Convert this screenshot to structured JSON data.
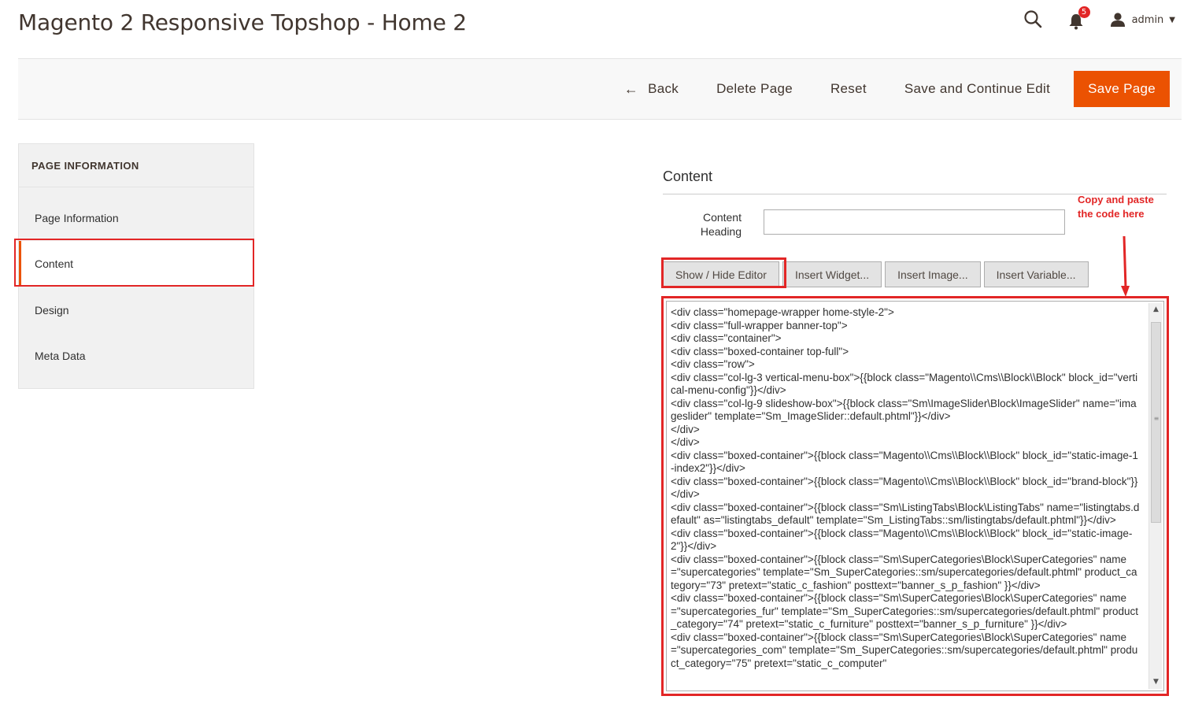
{
  "header": {
    "title": "Magento 2 Responsive Topshop - Home 2",
    "notification_count": "5",
    "user_name": "admin"
  },
  "actions": {
    "back": "Back",
    "delete": "Delete Page",
    "reset": "Reset",
    "save_continue": "Save and Continue Edit",
    "save": "Save Page"
  },
  "sidebar": {
    "title": "PAGE INFORMATION",
    "items": [
      {
        "label": "Page Information"
      },
      {
        "label": "Content"
      },
      {
        "label": "Design"
      },
      {
        "label": "Meta Data"
      }
    ]
  },
  "content": {
    "section_title": "Content",
    "heading_label": "Content Heading",
    "heading_value": "",
    "editor_buttons": {
      "show_hide": "Show / Hide Editor",
      "widget": "Insert Widget...",
      "image": "Insert Image...",
      "variable": "Insert Variable..."
    },
    "editor_value": "<div class=\"homepage-wrapper home-style-2\">\n<div class=\"full-wrapper banner-top\">\n<div class=\"container\">\n<div class=\"boxed-container top-full\">\n<div class=\"row\">\n<div class=\"col-lg-3 vertical-menu-box\">{{block class=\"Magento\\\\Cms\\\\Block\\\\Block\" block_id=\"vertical-menu-config\"}}</div>\n<div class=\"col-lg-9 slideshow-box\">{{block class=\"Sm\\ImageSlider\\Block\\ImageSlider\" name=\"imageslider\" template=\"Sm_ImageSlider::default.phtml\"}}</div>\n</div>\n</div>\n<div class=\"boxed-container\">{{block class=\"Magento\\\\Cms\\\\Block\\\\Block\" block_id=\"static-image-1-index2\"}}</div>\n<div class=\"boxed-container\">{{block class=\"Magento\\\\Cms\\\\Block\\\\Block\" block_id=\"brand-block\"}}</div>\n<div class=\"boxed-container\">{{block class=\"Sm\\ListingTabs\\Block\\ListingTabs\" name=\"listingtabs.default\" as=\"listingtabs_default\" template=\"Sm_ListingTabs::sm/listingtabs/default.phtml\"}}</div>\n<div class=\"boxed-container\">{{block class=\"Magento\\\\Cms\\\\Block\\\\Block\" block_id=\"static-image-2\"}}</div>\n<div class=\"boxed-container\">{{block class=\"Sm\\SuperCategories\\Block\\SuperCategories\" name=\"supercategories\" template=\"Sm_SuperCategories::sm/supercategories/default.phtml\" product_category=\"73\" pretext=\"static_c_fashion\" posttext=\"banner_s_p_fashion\" }}</div>\n<div class=\"boxed-container\">{{block class=\"Sm\\SuperCategories\\Block\\SuperCategories\" name=\"supercategories_fur\" template=\"Sm_SuperCategories::sm/supercategories/default.phtml\" product_category=\"74\" pretext=\"static_c_furniture\" posttext=\"banner_s_p_furniture\" }}</div>\n<div class=\"boxed-container\">{{block class=\"Sm\\SuperCategories\\Block\\SuperCategories\" name=\"supercategories_com\" template=\"Sm_SuperCategories::sm/supercategories/default.phtml\" product_category=\"75\" pretext=\"static_c_computer\""
  },
  "annotation": {
    "text": "Copy and paste the code here",
    "color": "#e22626"
  },
  "colors": {
    "primary": "#eb5202",
    "annotation_red": "#e22626"
  },
  "icons": {
    "search": "search-icon",
    "notifications": "bell-icon",
    "user": "user-icon",
    "back": "arrow-left-icon"
  }
}
